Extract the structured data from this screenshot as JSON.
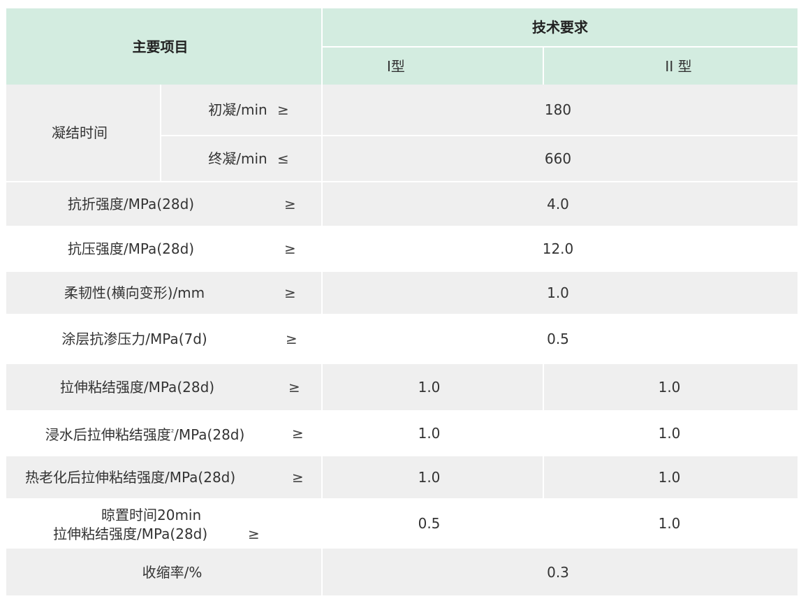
{
  "header": {
    "main_item": "主要项目",
    "tech_req": "技术要求",
    "type1": "I型",
    "type2": "II 型"
  },
  "rows": {
    "setting_time": {
      "label": "凝结时间",
      "initial": {
        "label": "初凝/min",
        "op": "≥",
        "value": "180"
      },
      "final": {
        "label": "终凝/min",
        "op": "≤",
        "value": "660"
      }
    },
    "flexural": {
      "label": "抗折强度/MPa(28d)",
      "op": "≥",
      "value": "4.0"
    },
    "compressive": {
      "label": "抗压强度/MPa(28d)",
      "op": "≥",
      "value": "12.0"
    },
    "flexibility": {
      "label": "柔韧性(横向变形)/mm",
      "op": "≥",
      "value": "1.0"
    },
    "impermeability": {
      "label": "涂层抗渗压力/MPa(7d)",
      "op": "≥",
      "value": "0.5"
    },
    "tensile_bond": {
      "label": "拉伸粘结强度/MPa(28d)",
      "op": "≥",
      "v1": "1.0",
      "v2": "1.0"
    },
    "tensile_bond_water": {
      "label_a": "浸水后拉伸粘结强度",
      "sup": "²",
      "label_b": "/MPa(28d)",
      "op": "≥",
      "v1": "1.0",
      "v2": "1.0"
    },
    "tensile_bond_heat": {
      "label": "热老化后拉伸粘结强度/MPa(28d)",
      "op": "≥",
      "v1": "1.0",
      "v2": "1.0"
    },
    "tensile_bond_open": {
      "label_line1": "晾置时间20min",
      "label_line2": "拉伸粘结强度/MPa(28d)",
      "op": "≥",
      "v1": "0.5",
      "v2": "1.0"
    },
    "shrinkage": {
      "label": "收缩率/%",
      "value": "0.3"
    }
  }
}
